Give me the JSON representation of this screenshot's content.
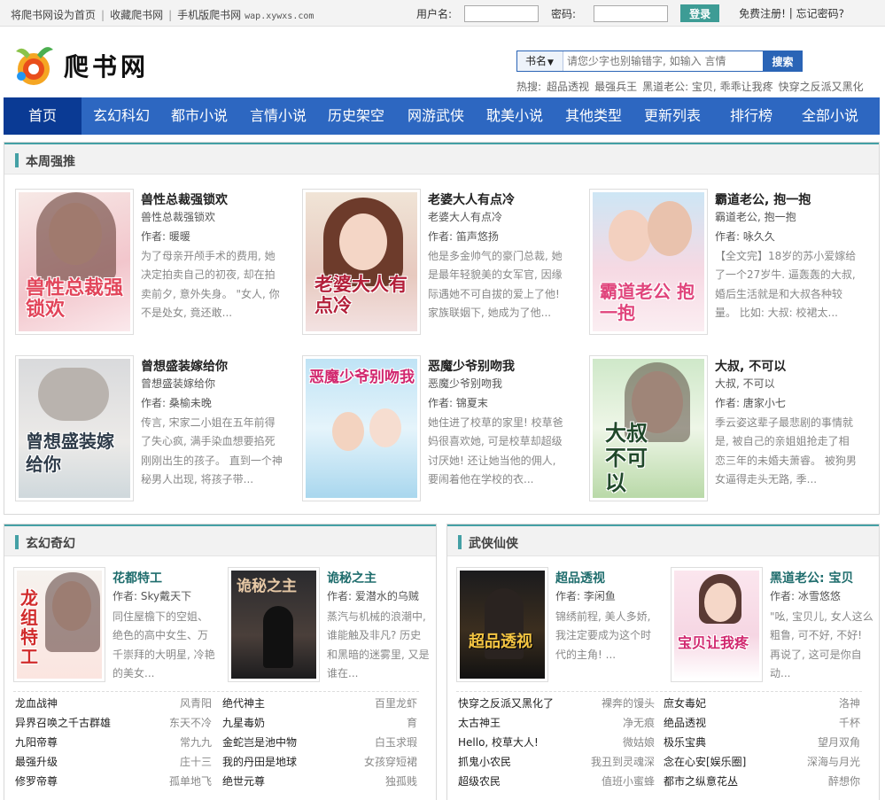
{
  "topbar": {
    "links": [
      "将爬书网设为首页",
      "收藏爬书网",
      "手机版爬书网"
    ],
    "mobile_domain": "wap.xywxs.com",
    "username_label": "用户名:",
    "password_label": "密码:",
    "login_button": "登录",
    "register_link": "免费注册!",
    "forgot_link": "忘记密码?"
  },
  "logo": {
    "text": "爬书网"
  },
  "search": {
    "category": "书名",
    "placeholder": "请您少字也别输错字, 如输入 言情",
    "button": "搜索",
    "hot_label": "热搜:",
    "hot": [
      "超品透视",
      "最强兵王",
      "黑道老公: 宝贝, 乖乖让我疼",
      "快穿之反派又黑化"
    ]
  },
  "nav": [
    "首页",
    "玄幻科幻",
    "都市小说",
    "言情小说",
    "历史架空",
    "网游武侠",
    "耽美小说",
    "其他类型",
    "更新列表",
    "排行榜",
    "全部小说"
  ],
  "colors": {
    "nav_bg": "#2d67c1",
    "nav_active": "#0a3a94",
    "accent": "#44a0a5",
    "login_button": "#3d9c95"
  },
  "weekly": {
    "title": "本周强推",
    "books": [
      {
        "title": "兽性总裁强锁欢",
        "subtitle": "兽性总裁强锁欢",
        "author": "作者: 暖暖",
        "desc": "为了母亲开颅手术的费用, 她决定拍卖自己的初夜, 却在拍卖前夕, 意外失身。 \"女人, 你不是处女, 竟还敢...",
        "cover": "兽性总裁强锁欢"
      },
      {
        "title": "老婆大人有点冷",
        "subtitle": "老婆大人有点冷",
        "author": "作者: 笛声悠扬",
        "desc": "他是多金帅气的豪门总裁, 她是最年轻貌美的女军官, 因缘际遇她不可自拔的爱上了他! 家族联姻下, 她成为了他...",
        "cover": "老婆大人有点冷"
      },
      {
        "title": "霸道老公, 抱一抱",
        "subtitle": "霸道老公, 抱一抱",
        "author": "作者: 咏久久",
        "desc": "【全文完】18岁的苏小爱嫁给了一个27岁牛. 逼轰轰的大叔, 婚后生活就是和大叔各种较量。 比如: 大叔: 校裙太...",
        "cover": "霸道老公 抱一抱"
      },
      {
        "title": "曾想盛装嫁给你",
        "subtitle": "曾想盛装嫁给你",
        "author": "作者: 桑榆未晚",
        "desc": "传言, 宋家二小姐在五年前得了失心疯, 满手染血想要掐死刚刚出生的孩子。 直到一个神秘男人出现, 将孩子带...",
        "cover": "曾想盛装嫁给你"
      },
      {
        "title": "恶魔少爷别吻我",
        "subtitle": "恶魔少爷别吻我",
        "author": "作者: 锦夏末",
        "desc": "她住进了校草的家里! 校草爸妈很喜欢她, 可是校草却超级讨厌她! 还让她当他的佣人, 要闹着他在学校的衣...",
        "cover": "恶魔少爷别吻我"
      },
      {
        "title": "大叔, 不可以",
        "subtitle": "大叔, 不可以",
        "author": "作者: 唐家小七",
        "desc": "季云姿这辈子最悲剧的事情就是, 被自己的亲姐姐抢走了相恋三年的未婚夫萧睿。 被狗男女逼得走头无路, 季...",
        "cover": "大叔不可以"
      }
    ]
  },
  "fantasy": {
    "title": "玄幻奇幻",
    "featured": [
      {
        "title": "花都特工",
        "author": "作者: Sky戴天下",
        "desc": "同住屋檐下的空姐、绝色的高中女生、万千崇拜的大明星, 冷艳的美女...",
        "cover": "龙组特工"
      },
      {
        "title": "诡秘之主",
        "author": "作者: 爱潜水的乌贼",
        "desc": "蒸汽与机械的浪潮中, 谁能触及非凡? 历史和黑暗的迷雾里, 又是谁在...",
        "cover": "诡秘之主"
      }
    ],
    "list": [
      [
        "龙血战神",
        "风青阳",
        "绝代神主",
        "百里龙虾"
      ],
      [
        "异界召唤之千古群雄",
        "东天不冷",
        "九星毒奶",
        "育"
      ],
      [
        "九阳帝尊",
        "常九九",
        "金蛇岂是池中物",
        "白玉求瑕"
      ],
      [
        "最强升级",
        "庄十三",
        "我的丹田是地球",
        "女孩穿短裙"
      ],
      [
        "修罗帝尊",
        "孤单地飞",
        "绝世元尊",
        "独孤贱"
      ]
    ]
  },
  "wuxia": {
    "title": "武侠仙侠",
    "featured": [
      {
        "title": "超品透视",
        "author": "作者: 李闲鱼",
        "desc": "锦绣前程, 美人多娇, 我注定要成为这个时代的主角! ...",
        "cover": "超品透视"
      },
      {
        "title": "黑道老公: 宝贝",
        "author": "作者: 冰雪悠悠",
        "desc": "\"吆, 宝贝儿, 女人这么粗鲁, 可不好, 不好! 再说了, 这可是你自动...",
        "cover": "宝贝让我疼"
      }
    ],
    "list": [
      [
        "快穿之反派又黑化了",
        "裸奔的馒头",
        "庶女毒妃",
        "洛神"
      ],
      [
        "太古神王",
        "净无痕",
        "绝品透视",
        "千杯"
      ],
      [
        "Hello, 校草大人!",
        "微姑娘",
        "极乐宝典",
        "望月双角"
      ],
      [
        "抓鬼小农民",
        "我丑到灵魂深",
        "念在心安[娱乐圈]",
        "深海与月光"
      ],
      [
        "超级农民",
        "值班小蜜蜂",
        "都市之纵意花丛",
        "醉想你"
      ]
    ]
  }
}
